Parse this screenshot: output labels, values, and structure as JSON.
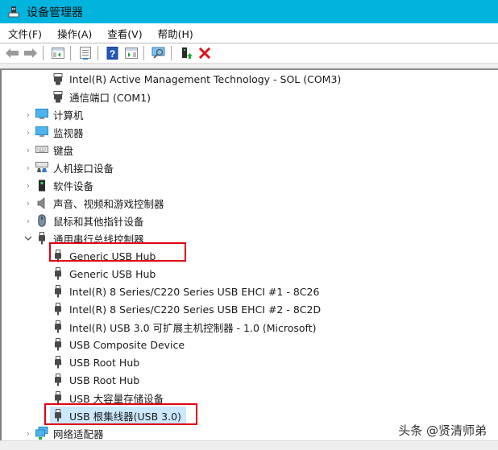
{
  "window": {
    "title": "设备管理器",
    "accent": "#00b4de"
  },
  "menu": [
    {
      "label": "文件(F)"
    },
    {
      "label": "操作(A)"
    },
    {
      "label": "查看(V)"
    },
    {
      "label": "帮助(H)"
    }
  ],
  "toolbar": [
    {
      "icon": "back-arrow-icon"
    },
    {
      "icon": "forward-arrow-icon"
    },
    {
      "icon": "show-hide-console-tree-icon"
    },
    {
      "icon": "properties-icon"
    },
    {
      "icon": "help-icon"
    },
    {
      "icon": "action-pane-icon"
    },
    {
      "icon": "scan-hardware-changes-icon"
    },
    {
      "icon": "update-driver-icon"
    },
    {
      "icon": "uninstall-device-icon"
    }
  ],
  "tree": {
    "ports_children": [
      {
        "label": "Intel(R) Active Management Technology - SOL (COM3)",
        "icon": "port-icon"
      },
      {
        "label": "通信端口 (COM1)",
        "icon": "port-icon"
      }
    ],
    "categories_top": [
      {
        "label": "计算机",
        "icon": "computer-icon",
        "expanded": false
      },
      {
        "label": "监视器",
        "icon": "monitor-icon",
        "expanded": false
      },
      {
        "label": "键盘",
        "icon": "keyboard-icon",
        "expanded": false
      },
      {
        "label": "人机接口设备",
        "icon": "hid-icon",
        "expanded": false
      },
      {
        "label": "软件设备",
        "icon": "software-device-icon",
        "expanded": false
      },
      {
        "label": "声音、视频和游戏控制器",
        "icon": "speaker-icon",
        "expanded": false
      },
      {
        "label": "鼠标和其他指针设备",
        "icon": "mouse-icon",
        "expanded": false
      }
    ],
    "usb_category": {
      "label": "通用串行总线控制器",
      "icon": "usb-icon",
      "expanded": true
    },
    "usb_children": [
      {
        "label": "Generic USB Hub",
        "highlighted": true,
        "selected": false
      },
      {
        "label": "Generic USB Hub",
        "highlighted": false,
        "selected": false
      },
      {
        "label": "Intel(R) 8 Series/C220 Series USB EHCI #1 - 8C26",
        "highlighted": false,
        "selected": false
      },
      {
        "label": "Intel(R) 8 Series/C220 Series USB EHCI #2 - 8C2D",
        "highlighted": false,
        "selected": false
      },
      {
        "label": "Intel(R) USB 3.0 可扩展主机控制器 - 1.0 (Microsoft)",
        "highlighted": false,
        "selected": false
      },
      {
        "label": "USB Composite Device",
        "highlighted": false,
        "selected": false
      },
      {
        "label": "USB Root Hub",
        "highlighted": false,
        "selected": false
      },
      {
        "label": "USB Root Hub",
        "highlighted": false,
        "selected": false
      },
      {
        "label": "USB 大容量存储设备",
        "highlighted": false,
        "selected": false
      },
      {
        "label": "USB 根集线器(USB 3.0)",
        "highlighted": true,
        "selected": true
      }
    ],
    "categories_bottom": [
      {
        "label": "网络适配器",
        "icon": "network-adapter-icon",
        "expanded": false
      }
    ]
  },
  "highlight_color": "#e00012",
  "watermark": "头条 @贤清师弟"
}
